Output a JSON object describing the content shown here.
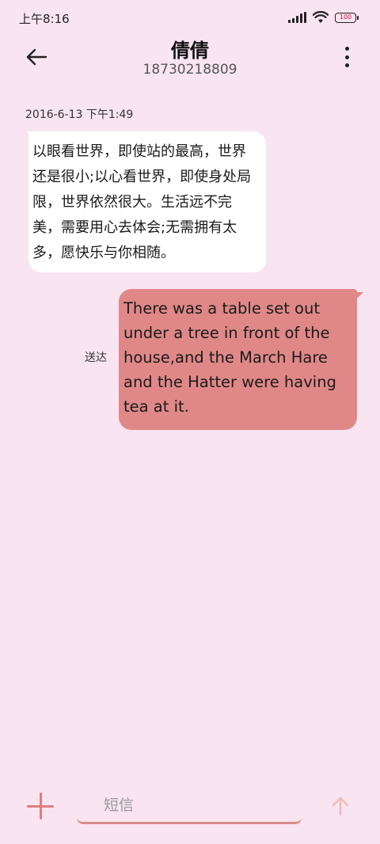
{
  "status_bar": {
    "time": "上午8:16",
    "battery": "100"
  },
  "header": {
    "contact_name": "倩倩",
    "phone_number": "18730218809"
  },
  "conversation": {
    "timestamp": "2016-6-13 下午1:49",
    "received_message": "以眼看世界，即使站的最高，世界还是很小;以心看世界，即使身处局限，世界依然很大。生活远不完美，需要用心去体会;无需拥有太多，愿快乐与你相随。",
    "sent_message": "There was a table set out under a tree in front of the house,and the March Hare and the Hatter were having tea at it.",
    "sent_status": "送达"
  },
  "composer": {
    "placeholder": "短信"
  },
  "colors": {
    "background": "#f9e4f1",
    "sent_bubble": "#e08888",
    "received_bubble": "#ffffff",
    "accent": "#e07c7c"
  },
  "icons": [
    "back-arrow-icon",
    "more-vert-icon",
    "cellular-signal-icon",
    "wifi-icon",
    "battery-icon",
    "add-icon",
    "send-arrow-icon"
  ]
}
